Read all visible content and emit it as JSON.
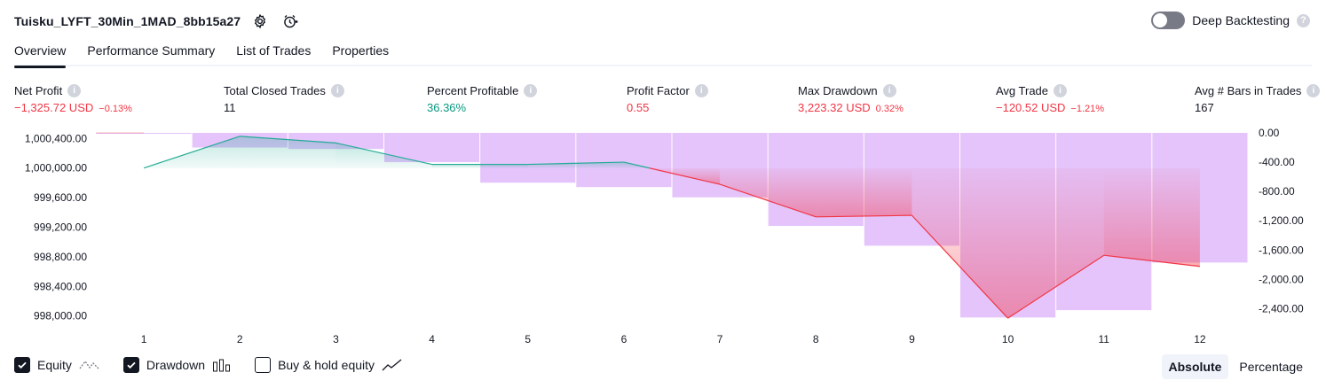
{
  "header": {
    "title": "Tuisku_LYFT_30Min_1MAD_8bb15a27",
    "deep_backtesting_label": "Deep Backtesting",
    "help_glyph": "?"
  },
  "tabs": [
    {
      "label": "Overview",
      "active": true
    },
    {
      "label": "Performance Summary",
      "active": false
    },
    {
      "label": "List of Trades",
      "active": false
    },
    {
      "label": "Properties",
      "active": false
    }
  ],
  "metrics": {
    "info_glyph": "i",
    "net_profit": {
      "label": "Net Profit",
      "value": "−1,325.72 USD",
      "pct": "−0.13%"
    },
    "total_closed_trades": {
      "label": "Total Closed Trades",
      "value": "11"
    },
    "percent_profitable": {
      "label": "Percent Profitable",
      "value": "36.36%"
    },
    "profit_factor": {
      "label": "Profit Factor",
      "value": "0.55"
    },
    "max_drawdown": {
      "label": "Max Drawdown",
      "value": "3,223.32 USD",
      "pct": "0.32%"
    },
    "avg_trade": {
      "label": "Avg Trade",
      "value": "−120.52 USD",
      "pct": "−1.21%"
    },
    "avg_bars": {
      "label": "Avg # Bars in Trades",
      "value": "167"
    }
  },
  "chart_data": {
    "type": "line",
    "x": [
      1,
      2,
      3,
      4,
      5,
      6,
      7,
      8,
      9,
      10,
      11,
      12
    ],
    "series": [
      {
        "name": "Equity",
        "values": [
          1000000,
          1000430,
          1000340,
          1000050,
          1000050,
          1000080,
          999780,
          999340,
          999360,
          997970,
          998820,
          998670
        ]
      },
      {
        "name": "Drawdown",
        "values": [
          0,
          -200,
          -220,
          -400,
          -680,
          -740,
          -880,
          -1270,
          -1540,
          -2520,
          -2420,
          -1770
        ]
      }
    ],
    "y_left_ticks": [
      "1,000,400.00",
      "1,000,000.00",
      "999,600.00",
      "999,200.00",
      "998,800.00",
      "998,400.00",
      "998,000.00"
    ],
    "y_right_ticks": [
      "0.00",
      "-400.00",
      "-800.00",
      "-1,200.00",
      "-1,600.00",
      "-2,000.00",
      "-2,400.00"
    ],
    "ylim_left": [
      997900,
      1000500
    ],
    "ylim_right": [
      -2600,
      0
    ],
    "initial_capital": 1000000,
    "colors": {
      "equity_up": "#22ab94",
      "equity_down": "#f23645",
      "drawdown": "#ce93f8"
    }
  },
  "legend": {
    "equity": {
      "label": "Equity",
      "checked": true
    },
    "drawdown": {
      "label": "Drawdown",
      "checked": true
    },
    "buy_hold": {
      "label": "Buy & hold equity",
      "checked": false
    }
  },
  "modes": [
    {
      "label": "Absolute",
      "active": true
    },
    {
      "label": "Percentage",
      "active": false
    }
  ]
}
